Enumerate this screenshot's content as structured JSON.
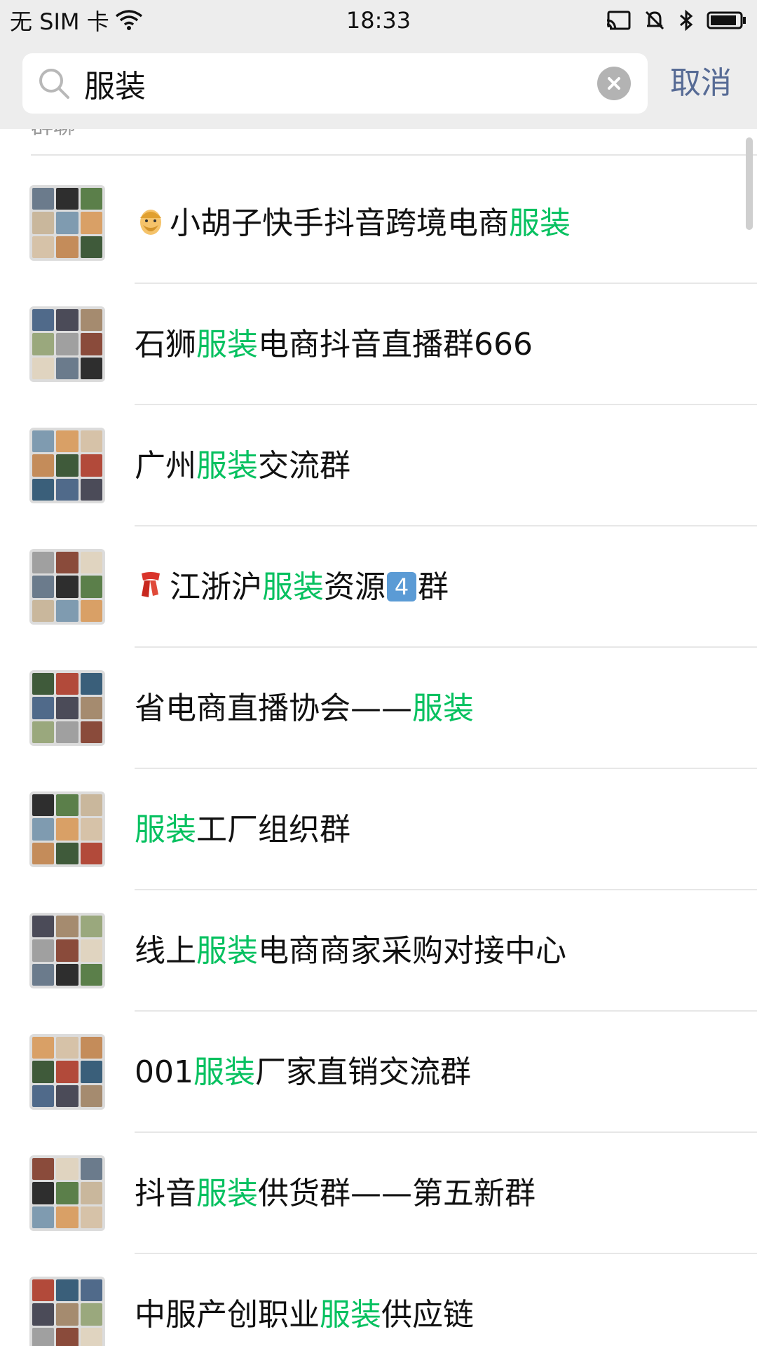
{
  "status_bar": {
    "carrier": "无 SIM 卡",
    "time": "18:33",
    "icons": [
      "wifi-icon",
      "cast-icon",
      "mute-icon",
      "bluetooth-icon",
      "battery-icon"
    ]
  },
  "search": {
    "value": "服装",
    "cancel_label": "取消"
  },
  "section": {
    "label": "群聊"
  },
  "highlight_color": "#07c160",
  "results": [
    {
      "emoji": "bearded-man-emoji",
      "parts": [
        "",
        "小胡子快手抖音跨境电商",
        "服装",
        ""
      ]
    },
    {
      "emoji": "",
      "parts": [
        "石狮",
        "服装",
        "电商抖音直播群666"
      ]
    },
    {
      "emoji": "",
      "parts": [
        "广州",
        "服装",
        "交流群"
      ]
    },
    {
      "emoji": "scarf-emoji",
      "parts": [
        "江浙沪",
        "服装",
        "资源",
        "4",
        "群"
      ]
    },
    {
      "emoji": "",
      "parts": [
        "省电商直播协会——",
        "服装",
        ""
      ]
    },
    {
      "emoji": "",
      "parts": [
        "",
        "服装",
        "工厂组织群"
      ]
    },
    {
      "emoji": "",
      "parts": [
        "线上",
        "服装",
        "电商商家采购对接中心"
      ]
    },
    {
      "emoji": "",
      "parts": [
        "001",
        "服装",
        "厂家直销交流群"
      ]
    },
    {
      "emoji": "",
      "parts": [
        "抖音",
        "服装",
        "供货群——第五新群"
      ]
    },
    {
      "emoji": "",
      "parts": [
        "中服产创职业",
        "服装",
        "供应链"
      ]
    }
  ]
}
